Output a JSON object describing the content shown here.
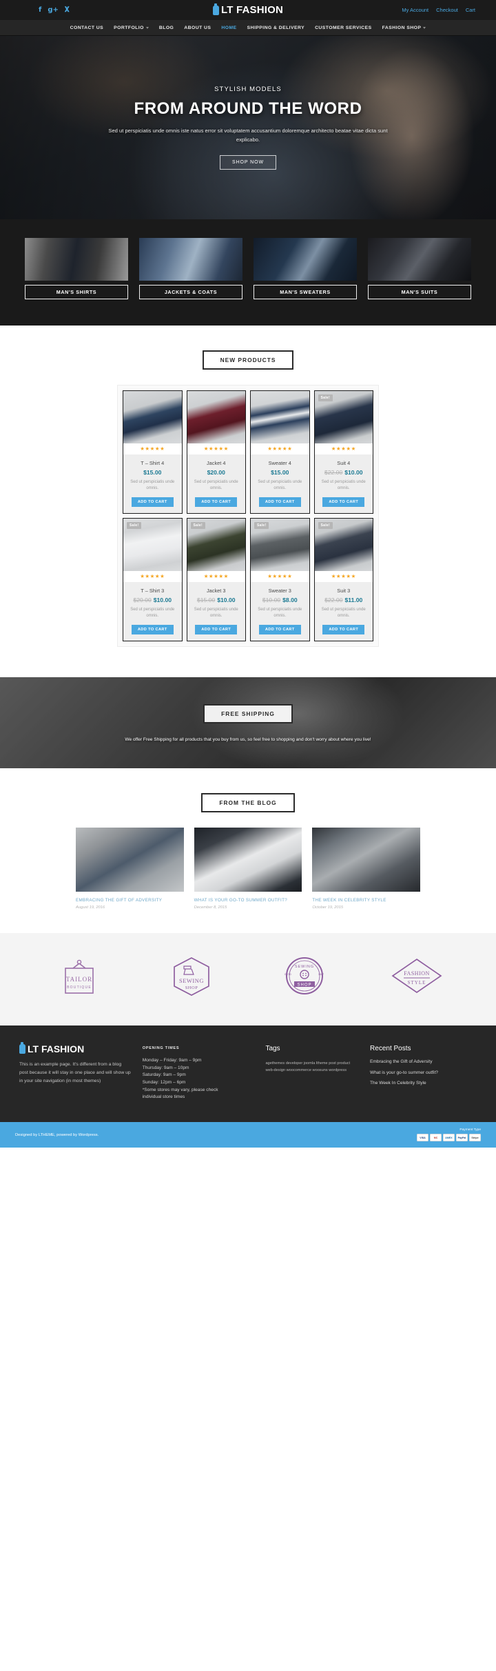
{
  "topbar": {
    "social": [
      {
        "name": "facebook-icon",
        "glyph": "f"
      },
      {
        "name": "google-plus-icon",
        "glyph": "g+"
      },
      {
        "name": "twitter-icon",
        "glyph": "t"
      }
    ],
    "brand": "LT FASHION",
    "links": [
      {
        "label": "My Account"
      },
      {
        "label": "Checkout"
      },
      {
        "label": "Cart"
      }
    ]
  },
  "nav": {
    "items": [
      {
        "label": "CONTACT US",
        "caret": false,
        "active": false
      },
      {
        "label": "PORTFOLIO",
        "caret": true,
        "active": false
      },
      {
        "label": "BLOG",
        "caret": false,
        "active": false
      },
      {
        "label": "ABOUT US",
        "caret": false,
        "active": false
      },
      {
        "label": "HOME",
        "caret": false,
        "active": true
      },
      {
        "label": "SHIPPING & DELIVERY",
        "caret": false,
        "active": false
      },
      {
        "label": "CUSTOMER SERVICES",
        "caret": false,
        "active": false
      },
      {
        "label": "FASHION SHOP",
        "caret": true,
        "active": false
      }
    ]
  },
  "hero": {
    "subtitle": "STYLISH MODELS",
    "title": "FROM AROUND THE WORD",
    "description": "Sed ut perspiciatis unde omnis iste natus error sit voluptatem accusantium doloremque architecto beatae vitae dicta sunt explicabo.",
    "button": "SHOP NOW"
  },
  "categories": [
    {
      "label": "MAN'S SHIRTS"
    },
    {
      "label": "JACKETS & COATS"
    },
    {
      "label": "MAN'S SWEATERS"
    },
    {
      "label": "MAN'S SUITS"
    }
  ],
  "products_section": {
    "title": "NEW PRODUCTS",
    "sale_badge": "Sale!",
    "stars": "★★★★★",
    "add_to_cart": "ADD TO CART",
    "rows": [
      [
        {
          "name": "T – Shirt 4",
          "old_price": "",
          "price": "$15.00",
          "desc": "Sed ut perspiciatis unde omnis.",
          "sale": false
        },
        {
          "name": "Jacket 4",
          "old_price": "",
          "price": "$20.00",
          "desc": "Sed ut perspiciatis unde omnis.",
          "sale": false
        },
        {
          "name": "Sweater 4",
          "old_price": "",
          "price": "$15.00",
          "desc": "Sed ut perspiciatis unde omnis.",
          "sale": false
        },
        {
          "name": "Suit 4",
          "old_price": "$22.00",
          "price": "$10.00",
          "desc": "Sed ut perspiciatis unde omnis.",
          "sale": true
        }
      ],
      [
        {
          "name": "T – Shirt 3",
          "old_price": "$20.00",
          "price": "$10.00",
          "desc": "Sed ut perspiciatis unde omnis.",
          "sale": true
        },
        {
          "name": "Jacket 3",
          "old_price": "$15.00",
          "price": "$10.00",
          "desc": "Sed ut perspiciatis unde omnis.",
          "sale": true
        },
        {
          "name": "Sweater 3",
          "old_price": "$10.00",
          "price": "$8.00",
          "desc": "Sed ut perspiciatis unde omnis.",
          "sale": true
        },
        {
          "name": "Suit 3",
          "old_price": "$22.00",
          "price": "$11.00",
          "desc": "Sed ut perspiciatis unde omnis.",
          "sale": true
        }
      ]
    ]
  },
  "shipping": {
    "title": "FREE SHIPPING",
    "text": "We offer Free Shipping for all products that you buy from us, so feel free to shopping and don't worry about where you live!"
  },
  "blog_section": {
    "title": "FROM THE BLOG",
    "posts": [
      {
        "title": "EMBRACING THE GIFT OF ADVERSITY",
        "date": "August 19, 2016"
      },
      {
        "title": "WHAT IS YOUR GO-TO SUMMER OUTFIT?",
        "date": "December 8, 2015"
      },
      {
        "title": "THE WEEK IN CELEBRITY STYLE",
        "date": "October 19, 2015"
      }
    ]
  },
  "brands": [
    {
      "name": "tailor-boutique-logo",
      "line1": "TAILOR",
      "line2": "BOUTIQUE"
    },
    {
      "name": "sewing-shop-hex-logo",
      "line1": "SEWING",
      "line2": "SHOP"
    },
    {
      "name": "sewing-shop-circle-logo",
      "line1": "SEWING",
      "line2": "SHOP",
      "est": "ESTD",
      "year": "1987"
    },
    {
      "name": "fashion-style-logo",
      "line1": "FASHION",
      "line2": "STYLE"
    }
  ],
  "footer": {
    "brand": "LT FASHION",
    "about": "This is an example page. It's different from a blog post because it will stay in one place and will show up in your site navigation (in most themes)",
    "opening_heading": "OPENING TIMES",
    "opening_lines": [
      "Monday – Friday: 9am – 9pm",
      "Thursday: 9am – 10pm",
      "Saturday: 9am – 9pm",
      "Sunday: 12pm – 6pm",
      "*Some stores may vary, please check",
      "individual store times"
    ],
    "tags_heading": "Tags",
    "tags": [
      "agethemes",
      "developer",
      "joomla",
      "ltheme",
      "post",
      "product",
      "web-design",
      "woocommerce",
      "woosuns",
      "wordpress"
    ],
    "recent_heading": "Recent Posts",
    "recent_posts": [
      "Embracing the Gift of Adversity",
      "What is your go-to summer outfit?",
      "The Week In Celebrity Style"
    ]
  },
  "copyright": {
    "text": "Designed by LTHEME, powered by Wordpress.",
    "payment_label": "Payment Type",
    "cards": [
      "VISA",
      "MC",
      "AMEX",
      "PayPal",
      "Stripe"
    ]
  },
  "colors": {
    "accent": "#4aa8e0",
    "price": "#1c7a93",
    "star": "#f5a623",
    "dark": "#1a1a1a"
  }
}
